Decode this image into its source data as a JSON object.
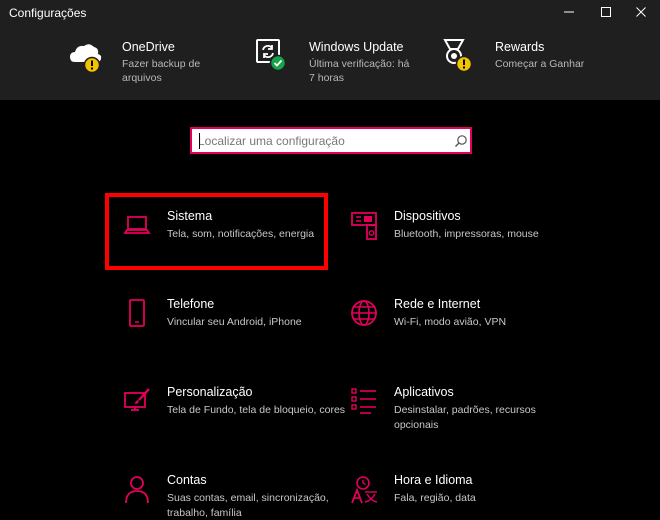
{
  "window": {
    "title": "Configurações"
  },
  "header": {
    "items": [
      {
        "title": "OneDrive",
        "subtitle": "Fazer backup de arquivos",
        "icon": "onedrive-cloud-icon",
        "badge": "warning-badge-icon"
      },
      {
        "title": "Windows Update",
        "subtitle": "Última verificação: há 7 horas",
        "icon": "windows-update-icon",
        "badge": "check-badge-icon"
      },
      {
        "title": "Rewards",
        "subtitle": "Começar a Ganhar",
        "icon": "rewards-medal-icon",
        "badge": "warning-badge-icon"
      }
    ]
  },
  "search": {
    "placeholder": "Localizar uma configuração",
    "icon": "search-icon"
  },
  "categories": [
    {
      "title": "Sistema",
      "subtitle": "Tela, som, notificações, energia",
      "icon": "laptop-icon"
    },
    {
      "title": "Dispositivos",
      "subtitle": "Bluetooth, impressoras, mouse",
      "icon": "devices-icon"
    },
    {
      "title": "Telefone",
      "subtitle": "Vincular seu Android, iPhone",
      "icon": "phone-icon"
    },
    {
      "title": "Rede e Internet",
      "subtitle": "Wi-Fi, modo avião, VPN",
      "icon": "globe-icon"
    },
    {
      "title": "Personalização",
      "subtitle": "Tela de Fundo, tela de bloqueio, cores",
      "icon": "personalization-icon"
    },
    {
      "title": "Aplicativos",
      "subtitle": "Desinstalar, padrões, recursos opcionais",
      "icon": "apps-list-icon"
    },
    {
      "title": "Contas",
      "subtitle": "Suas contas, email, sincronização, trabalho, família",
      "icon": "person-icon"
    },
    {
      "title": "Hora e Idioma",
      "subtitle": "Fala, região, data",
      "icon": "time-language-icon"
    }
  ],
  "colors": {
    "accent": "#e3005c",
    "highlight": "#ff0000",
    "header_bg": "#1f1f1f",
    "warning": "#f2c400",
    "success": "#16a34a"
  }
}
